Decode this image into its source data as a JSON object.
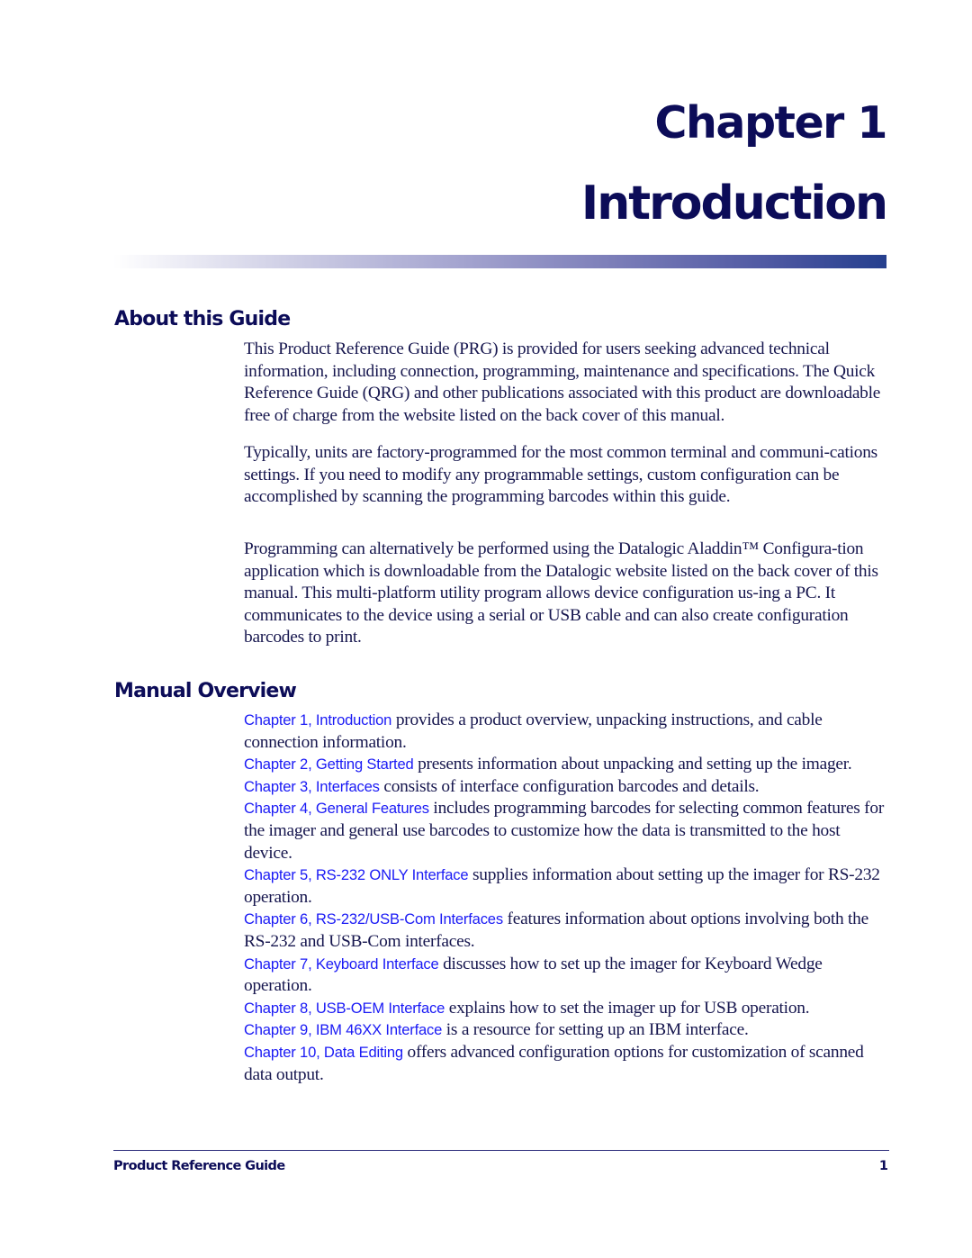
{
  "header": {
    "chapter_label": "Chapter 1",
    "chapter_title": "Introduction"
  },
  "colors": {
    "heading": "#0c0c58",
    "body_text": "#16164e",
    "link": "#1a1af5",
    "bar_end": "#253f8e"
  },
  "about": {
    "heading": "About this Guide",
    "paragraphs": [
      "This Product Reference Guide (PRG) is provided for users seeking advanced technical information, including connection, programming, maintenance and specifications. The Quick Reference Guide (QRG) and other publications associated with this product are downloadable free of charge from the website listed on the back cover of this manual.",
      "Typically, units are factory-programmed for the most common terminal and communi-cations settings. If you need to modify any programmable settings, custom configuration can be accomplished by scanning the programming barcodes within this guide.",
      "Programming can alternatively be performed using the Datalogic Aladdin™ Configura-tion application which is downloadable from the Datalogic website listed on the back cover of this manual. This multi-platform utility program allows device configuration us-ing a PC. It communicates to the device using a serial or USB cable and can also create configuration barcodes to print."
    ]
  },
  "overview": {
    "heading": "Manual Overview",
    "items": [
      {
        "link": "Chapter 1, Introduction",
        "text": " provides a product overview, unpacking instructions, and cable connection information."
      },
      {
        "link": "Chapter 2, Getting Started",
        "text": " presents information about unpacking and setting up the imager."
      },
      {
        "link": "Chapter 3, Interfaces",
        "text": " consists of interface configuration barcodes and details."
      },
      {
        "link": "Chapter 4, General Features",
        "text": " includes programming barcodes for selecting common features for the imager and general use barcodes to customize how the data is transmitted to the host device."
      },
      {
        "link": "Chapter 5, RS-232 ONLY Interface",
        "text": " supplies information about setting up the imager for RS-232 operation."
      },
      {
        "link": "Chapter 6, RS-232/USB-Com Interfaces",
        "text": " features information about options involving both the RS-232 and USB-Com interfaces."
      },
      {
        "link": "Chapter 7, Keyboard Interface",
        "text": " discusses how to set up the imager for Keyboard Wedge operation."
      },
      {
        "link": "Chapter 8, USB-OEM Interface",
        "text": " explains how to set the imager up for USB operation."
      },
      {
        "link": "Chapter 9, IBM 46XX Interface",
        "text": " is a resource for setting up an IBM interface."
      },
      {
        "link": "Chapter 10, Data Editing",
        "text": " offers advanced configuration options for customization of scanned data output."
      }
    ]
  },
  "footer": {
    "title": "Product Reference Guide",
    "page_number": "1"
  }
}
